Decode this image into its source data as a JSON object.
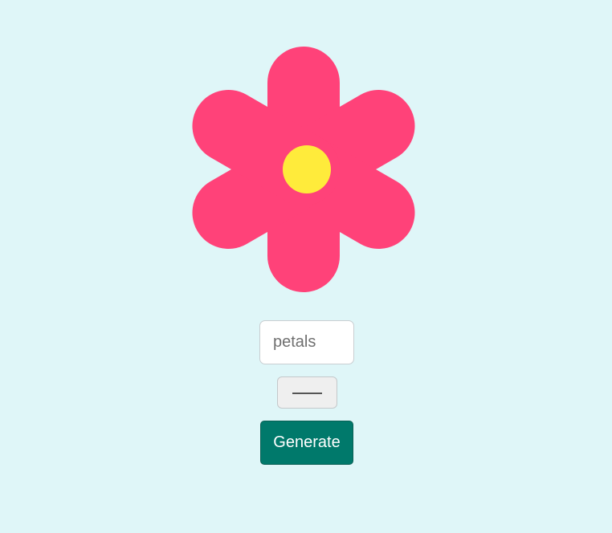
{
  "colors": {
    "background": "#dff6f8",
    "petal": "#ff4279",
    "center": "#ffeb3b",
    "generate_button": "#00796b"
  },
  "flower": {
    "petal_count": 6
  },
  "petals_input": {
    "placeholder": "petals",
    "value": ""
  },
  "separator_button": {
    "icon": "horizontal-line-icon"
  },
  "generate_button": {
    "label": "Generate"
  }
}
